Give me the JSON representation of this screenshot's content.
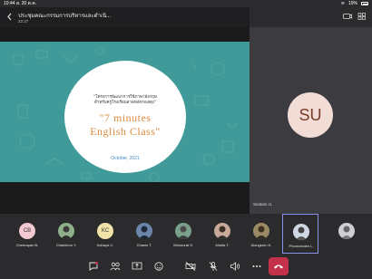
{
  "status": {
    "time": "10:44",
    "info": "ส. 20 ต.ค.",
    "battery_pct": "19%"
  },
  "header": {
    "title": "ประชุมคณะกรรมการบริหารและดำเนิ...",
    "elapsed": "22:37"
  },
  "slide": {
    "thai_line1": "\"โครงการพัฒนาการใช้ภาษาอังกฤษ",
    "thai_line2": "สำหรับครูโรงเรียนลาดหลักกองคุม\"",
    "title_line1": "\"7 minutes",
    "title_line2": "English Class\"",
    "date": "October, 2021"
  },
  "presenter_tag": "Siratam U.",
  "self": {
    "initials": "SU",
    "name": "Siratam U."
  },
  "participants": [
    {
      "label": "Cheerapan B.",
      "initials": "CB",
      "color": "#f3c9d2"
    },
    {
      "label": "Chanitnun Y.",
      "initials": "",
      "color": "#8fb08a"
    },
    {
      "label": "Kahaya C.",
      "initials": "KC",
      "color": "#f1e3a8"
    },
    {
      "label": "Chanin T.",
      "initials": "",
      "color": "#6b86a8"
    },
    {
      "label": "Wimonrat S.",
      "initials": "",
      "color": "#7aa08b"
    },
    {
      "label": "Mukta T.",
      "initials": "",
      "color": "#c7a899"
    },
    {
      "label": "Alongkorn K.",
      "initials": "",
      "color": "#9a8a63"
    },
    {
      "label": "Phorncholee L.",
      "initials": "",
      "color": "#d0d8e6"
    },
    {
      "label": "",
      "initials": "",
      "color": "#cfcfd4"
    }
  ],
  "icons": {
    "back": "chevron-left-icon",
    "chat": "chat-icon",
    "people": "people-icon",
    "share": "share-screen-icon",
    "reactions": "reactions-icon",
    "camera": "camera-off-icon",
    "mic": "mic-off-icon",
    "speaker": "speaker-icon",
    "more": "more-icon",
    "leave": "hang-up-icon"
  },
  "colors": {
    "slide_bg": "#3f9a99",
    "title_orange": "#d98a3c",
    "hangup_red": "#c4314b",
    "active_ring": "#8a8fe8"
  }
}
